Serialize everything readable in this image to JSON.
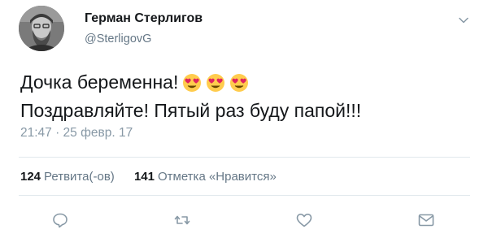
{
  "user": {
    "display_name": "Герман Стерлигов",
    "handle": "@SterligovG",
    "avatar_icon": "profile-photo"
  },
  "tweet": {
    "line1": "Дочка беременна!",
    "line2": "Поздравляйте! Пятый раз буду папой!!!",
    "emoji_names": [
      "smiling-face-with-heart-eyes",
      "smiling-face-with-heart-eyes",
      "smiling-face-with-heart-eyes"
    ],
    "timestamp": "21:47 · 25 февр. 17"
  },
  "stats": {
    "retweets_count": "124",
    "retweets_label": "Ретвита(-ов)",
    "likes_count": "141",
    "likes_label": "Отметка «Нравится»"
  },
  "actions": {
    "reply_icon": "reply-icon",
    "retweet_icon": "retweet-icon",
    "like_icon": "heart-icon",
    "dm_icon": "envelope-icon"
  },
  "colors": {
    "text_primary": "#14171a",
    "text_secondary": "#657786",
    "icon_gray": "#8899a6",
    "divider": "#e1e8ed",
    "emoji_yellow": "#ffcc4d",
    "emoji_heart": "#e0245e"
  }
}
